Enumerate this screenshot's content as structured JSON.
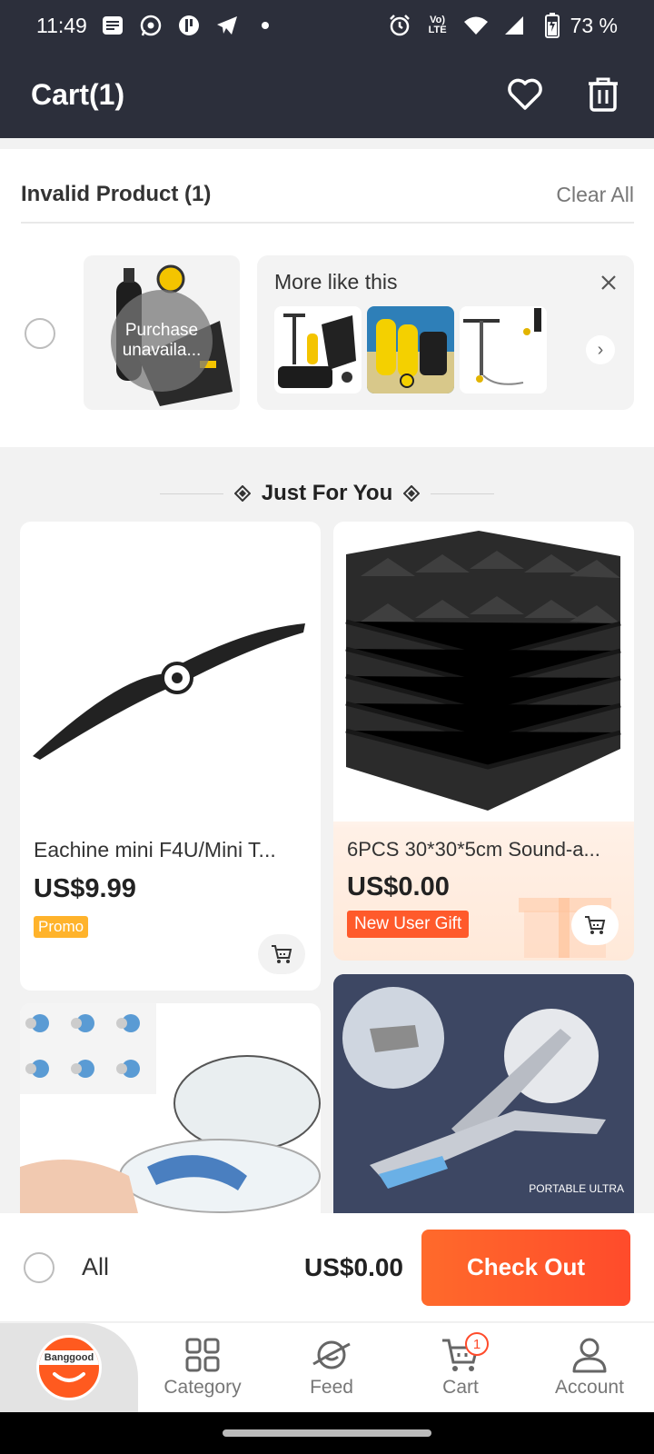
{
  "status_bar": {
    "time": "11:49",
    "battery": "73 %",
    "left_icons": [
      "message-icon",
      "whatsapp-icon",
      "app-icon",
      "telegram-icon",
      "dot-icon"
    ],
    "right_icons": [
      "alarm-icon",
      "volte-icon",
      "wifi-icon",
      "signal-icon",
      "battery-icon"
    ]
  },
  "header": {
    "title": "Cart(1)",
    "icons": [
      "heart-icon",
      "trash-icon"
    ]
  },
  "invalid_section": {
    "title": "Invalid Product (1)",
    "clear_all": "Clear All",
    "unavailable_label": "Purchase unavaila...",
    "more_like_this": "More like this",
    "next_icon": "›"
  },
  "just_for_you": {
    "title": "Just For You"
  },
  "products": [
    {
      "name": "Eachine mini F4U/Mini T...",
      "price": "US$9.99",
      "badge": "Promo"
    },
    {
      "name": "6PCS 30*30*5cm Sound-a...",
      "price": "US$0.00",
      "badge": "New User Gift"
    }
  ],
  "footer_bar": {
    "all_label": "All",
    "total": "US$0.00",
    "checkout_label": "Check Out"
  },
  "bottom_nav": {
    "logo_text": "Banggood",
    "items": [
      {
        "label": "Category",
        "icon": "grid-icon"
      },
      {
        "label": "Feed",
        "icon": "planet-icon"
      },
      {
        "label": "Cart",
        "icon": "cart-icon",
        "badge": "1"
      },
      {
        "label": "Account",
        "icon": "person-icon"
      }
    ]
  },
  "colors": {
    "header_bg": "#2c2f3b",
    "accent": "#ff5a2b",
    "promo_badge": "#ffb32b",
    "gift_badge": "#ff5a2b"
  }
}
